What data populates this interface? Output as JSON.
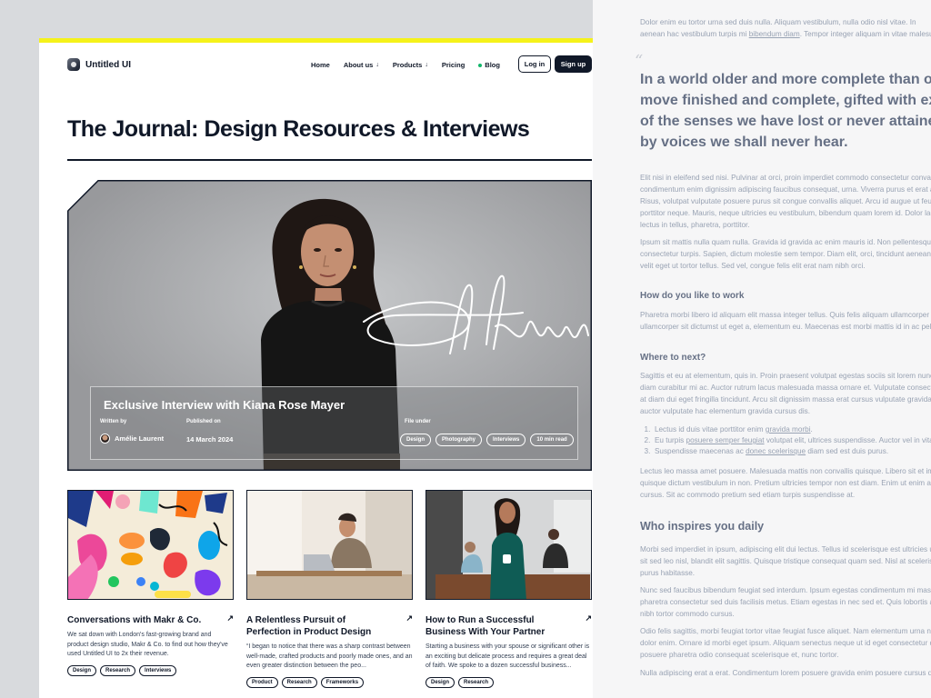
{
  "nav": {
    "logo_text": "Untitled UI",
    "links": [
      "Home",
      "About us",
      "Products",
      "Pricing",
      "Blog"
    ],
    "login": "Log in",
    "signup": "Sign up"
  },
  "page_title": "The Journal: Design Resources & Interviews",
  "hero": {
    "title": "Exclusive Interview with Kiana Rose Mayer",
    "written_by_label": "Written by",
    "author": "Amélie Laurent",
    "published_label": "Published on",
    "date": "14 March 2024",
    "file_under_label": "File under",
    "tags": [
      "Design",
      "Photography",
      "Interviews",
      "10 min read"
    ]
  },
  "posts": [
    {
      "title": "Conversations with Makr & Co.",
      "desc": "We sat down with London's fast-growing brand and product design studio, Makr & Co. to find out how they've used Untitled UI to 2x their revenue.",
      "tags": [
        "Design",
        "Research",
        "Interviews"
      ]
    },
    {
      "title": "A Relentless Pursuit of Perfection in Product Design",
      "desc": "“I began to notice that there was a sharp contrast between well-made, crafted products and poorly made ones, and an even greater distinction between the peo...",
      "tags": [
        "Product",
        "Research",
        "Frameworks"
      ]
    },
    {
      "title": "How to Run a Successful Business With Your Partner",
      "desc": "Starting a business with your spouse or significant other is an exciting but delicate process and requires a great deal of faith. We spoke to a dozen successful business...",
      "tags": [
        "Design",
        "Research"
      ]
    }
  ],
  "article": {
    "intro_1": "Dolor enim eu tortor urna sed duis nulla. Aliquam vestibulum, nulla odio nisl vitae. In",
    "intro_2a": "aenean hac vestibulum turpis mi ",
    "intro_2_link": "bibendum diam",
    "intro_2b": ". Tempor integer aliquam in vitae malesuada.",
    "quote": [
      "In a world older and more complete than ours they",
      "move finished and complete, gifted with extensions",
      "of the senses we have lost or never attained, living",
      "by voices we shall never hear."
    ],
    "p1": [
      "Elit nisi in eleifend sed nisi. Pulvinar at orci, proin imperdiet commodo consectetur convallis risus. Sed",
      "condimentum enim dignissim adipiscing faucibus consequat, urna. Viverra purus et erat auctor aliquam.",
      "Risus, volutpat vulputate posuere purus sit congue convallis aliquet. Arcu id augue ut feugiat donec",
      "porttitor neque. Mauris, neque ultricies eu vestibulum, bibendum quam lorem id. Dolor lacus, eget nunc",
      "lectus in tellus, pharetra, porttitor."
    ],
    "p2": [
      "Ipsum sit mattis nulla quam nulla. Gravida id gravida ac enim mauris id. Non pellentesque congue eget",
      "consectetur turpis. Sapien, dictum molestie sem tempor. Diam elit, orci, tincidunt aenean tempus. Quis",
      "velit eget ut tortor tellus. Sed vel, congue felis elit erat nam nibh orci."
    ],
    "h1": "How do you like to work",
    "p3": [
      "Pharetra morbi libero id aliquam elit massa integer tellus. Quis felis aliquam ullamcorper porttitor. Pulvinar",
      "ullamcorper sit dictumst ut eget a, elementum eu. Maecenas est morbi mattis id in ac pellentesque ac."
    ],
    "h2": "Where to next?",
    "p4": [
      "Sagittis et eu at elementum, quis in. Proin praesent volutpat egestas sociis sit lorem nunc nunc sit. Eget",
      "diam curabitur mi ac. Auctor rutrum lacus malesuada massa ornare et. Vulputate consectetur ac ultrices",
      "at diam dui eget fringilla tincidunt. Arcu sit dignissim massa erat cursus vulputate gravida id. Sed quis",
      "auctor vulputate hac elementum gravida cursus dis."
    ],
    "list": [
      {
        "a": "Lectus id duis vitae porttitor enim ",
        "link": "gravida morbi",
        "b": "."
      },
      {
        "a": "Eu turpis ",
        "link": "posuere semper feugiat",
        "b": " volutpat elit, ultrices suspendisse. Auctor vel in vitae placerat."
      },
      {
        "a": "Suspendisse maecenas ac ",
        "link": "donec scelerisque",
        "b": " diam sed est duis purus."
      }
    ],
    "p5": [
      "Lectus leo massa amet posuere. Malesuada mattis non convallis quisque. Libero sit et imperdiet bibendum",
      "quisque dictum vestibulum in non. Pretium ultricies tempor non est diam. Enim ut enim amet amet integer",
      "cursus. Sit ac commodo pretium sed etiam turpis suspendisse at."
    ],
    "h3": "Who inspires you daily",
    "p6": [
      "Morbi sed imperdiet in ipsum, adipiscing elit dui lectus. Tellus id scelerisque est ultricies ultricies. Duis est",
      "sit sed leo nisl, blandit elit sagittis. Quisque tristique consequat quam sed. Nisl at scelerisque amet nulla",
      "purus habitasse."
    ],
    "p7": [
      "Nunc sed faucibus bibendum feugiat sed interdum. Ipsum egestas condimentum mi massa. In tincidunt",
      "pharetra consectetur sed duis facilisis metus. Etiam egestas in nec sed et. Quis lobortis at sit dictum eget",
      "nibh tortor commodo cursus."
    ],
    "p8": [
      "Odio felis sagittis, morbi feugiat tortor vitae feugiat fusce aliquet. Nam elementum urna nisi aliquet erat",
      "dolor enim. Ornare id morbi eget ipsum. Aliquam senectus neque ut id eget consectetur dictum. Donec",
      "posuere pharetra odio consequat scelerisque et, nunc tortor."
    ],
    "p9": [
      "Nulla adipiscing erat a erat. Condimentum lorem posuere gravida enim posuere cursus diam."
    ]
  },
  "colors": {
    "accent_bar": "#f5f21b",
    "ink": "#101828",
    "status_dot": "#12b76a"
  }
}
